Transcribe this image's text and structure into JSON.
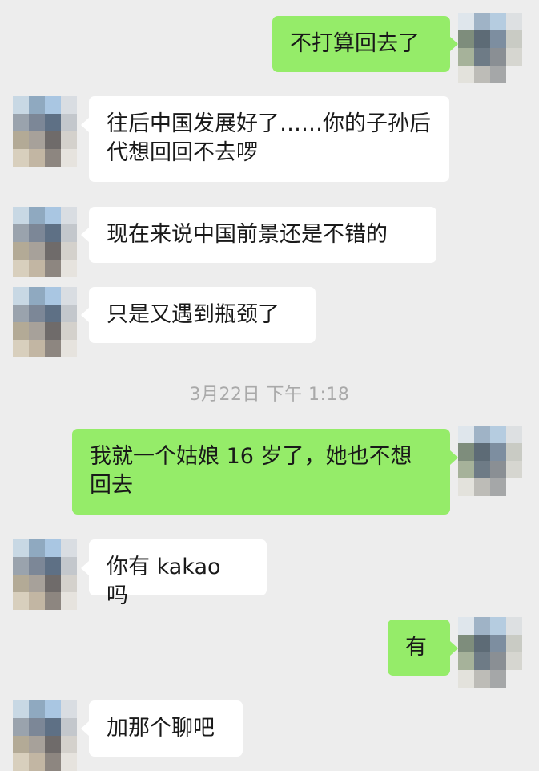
{
  "chat": {
    "messages": [
      {
        "side": "out",
        "text": "不打算回去了"
      },
      {
        "side": "in",
        "text": "往后中国发展好了……你的子孙后代想回回不去啰"
      },
      {
        "side": "in",
        "text": "现在来说中国前景还是不错的"
      },
      {
        "side": "in",
        "text": "只是又遇到瓶颈了"
      },
      {
        "side": "out",
        "text": "我就一个姑娘 16 岁了，她也不想回去"
      },
      {
        "side": "in",
        "text": "你有 kakao 吗"
      },
      {
        "side": "out",
        "text": "有"
      },
      {
        "side": "in",
        "text": "加那个聊吧"
      }
    ],
    "timestamp": "3月22日 下午 1:18"
  },
  "avatars": {
    "contact_palette": [
      "#c8d8e4",
      "#8fa9c0",
      "#a9c6e2",
      "#d9dde2",
      "#9aa3ad",
      "#7c8797",
      "#5e7085",
      "#c3c7cc",
      "#b3aa96",
      "#a7a19a",
      "#6f6b6a",
      "#d4d1cc",
      "#d8cfbd",
      "#c2b6a3",
      "#8d8680",
      "#e6e3de"
    ],
    "self_palette": [
      "#dfe6ec",
      "#9fb3c6",
      "#b5cce0",
      "#dde0e2",
      "#7e8d7c",
      "#5d6b76",
      "#7d8ea0",
      "#c9cbc4",
      "#a6b29a",
      "#6e7b86",
      "#8a8f94",
      "#d6d6d0",
      "#e3e2dc",
      "#bdbcb7",
      "#a5a7a8",
      "#ededed"
    ]
  }
}
